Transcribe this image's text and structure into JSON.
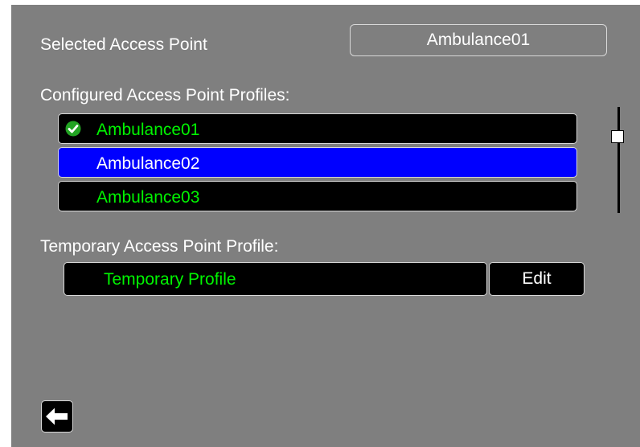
{
  "selected_access_point": {
    "label": "Selected Access Point",
    "value": "Ambulance01"
  },
  "configured_profiles": {
    "label": "Configured Access Point Profiles:",
    "items": [
      {
        "name": "Ambulance01",
        "active": true,
        "selected": false
      },
      {
        "name": "Ambulance02",
        "active": false,
        "selected": true
      },
      {
        "name": "Ambulance03",
        "active": false,
        "selected": false
      }
    ]
  },
  "temporary_profile": {
    "label": "Temporary Access Point Profile:",
    "value": "Temporary Profile",
    "edit_label": "Edit"
  },
  "icons": {
    "active_profile": "check-circle-icon",
    "back": "arrow-left-icon"
  },
  "colors": {
    "background": "#7f7f7f",
    "highlight": "#0000ff",
    "profile_text": "#00f400",
    "check": "#20a020"
  }
}
